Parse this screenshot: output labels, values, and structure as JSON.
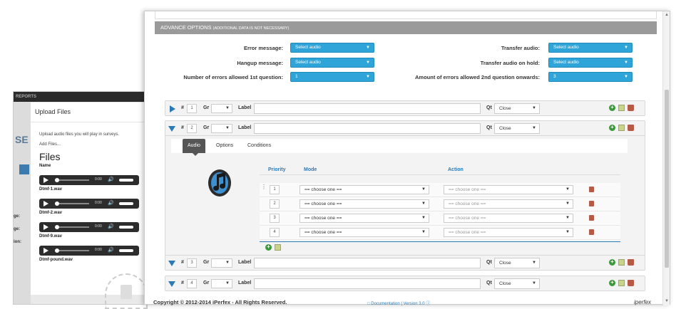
{
  "bg_app": {
    "nav_label": "REPORTS",
    "side_text": "SE",
    "side_labels": [
      "ge:",
      "ge:",
      "ion:"
    ]
  },
  "upload": {
    "title": "Upload Files",
    "description": "Upload audio files you will play in surveys.",
    "add_files": "Add Files...",
    "files_heading": "Files",
    "name_col": "Name",
    "files": [
      {
        "time": "0:00",
        "name": "Dtmf-1.wav"
      },
      {
        "time": "0:00",
        "name": "Dtmf-2.wav"
      },
      {
        "time": "0:00",
        "name": "Dtmf-9.wav"
      },
      {
        "time": "0:00",
        "name": "Dtmf-pound.wav"
      }
    ]
  },
  "advance": {
    "title": "ADVANCE OPTIONS",
    "subtitle": "(ADDITIONAL DATA IS NOT NECESSARY)",
    "fields": {
      "error_message": {
        "label": "Error message:",
        "value": "Select audio"
      },
      "hangup_message": {
        "label": "Hangup message:",
        "value": "Select audio"
      },
      "errors_first": {
        "label": "Number of errors allowed 1st question:",
        "value": "1"
      },
      "transfer_audio": {
        "label": "Transfer audio:",
        "value": "Select audio"
      },
      "transfer_hold": {
        "label": "Transfer audio on hold:",
        "value": "Select audio"
      },
      "errors_onwards": {
        "label": "Amount of errors allowed 2nd question onwards:",
        "value": "3"
      }
    }
  },
  "question_labels": {
    "hash": "#",
    "gr": "Gr",
    "label": "Label",
    "qt": "Qt"
  },
  "questions": [
    {
      "number": "1",
      "qt": "Close"
    },
    {
      "number": "2",
      "qt": "Close"
    },
    {
      "number": "3",
      "qt": "Close"
    },
    {
      "number": "4",
      "qt": "Close"
    }
  ],
  "detail": {
    "tabs": [
      "Audio",
      "Options",
      "Conditions"
    ],
    "columns": {
      "priority": "Priority",
      "mode": "Mode",
      "action": "Action"
    },
    "rows": [
      {
        "priority": "1",
        "mode": "== choose one ==",
        "action": "== choose one =="
      },
      {
        "priority": "2",
        "mode": "== choose one ==",
        "action": "== choose one =="
      },
      {
        "priority": "3",
        "mode": "== choose one ==",
        "action": "== choose one =="
      },
      {
        "priority": "4",
        "mode": "== choose one ==",
        "action": "== choose one =="
      }
    ]
  },
  "footer": {
    "copyright": "Copyright © 2012-2014 iPerfex - All Rights Reserved.",
    "doc_link": "Documentation | Version 3.0",
    "logo": "iperfex"
  },
  "colors": {
    "accent": "#2fa4d8",
    "toggle": "#2a7ab8",
    "bar": "#9a9a9a"
  }
}
